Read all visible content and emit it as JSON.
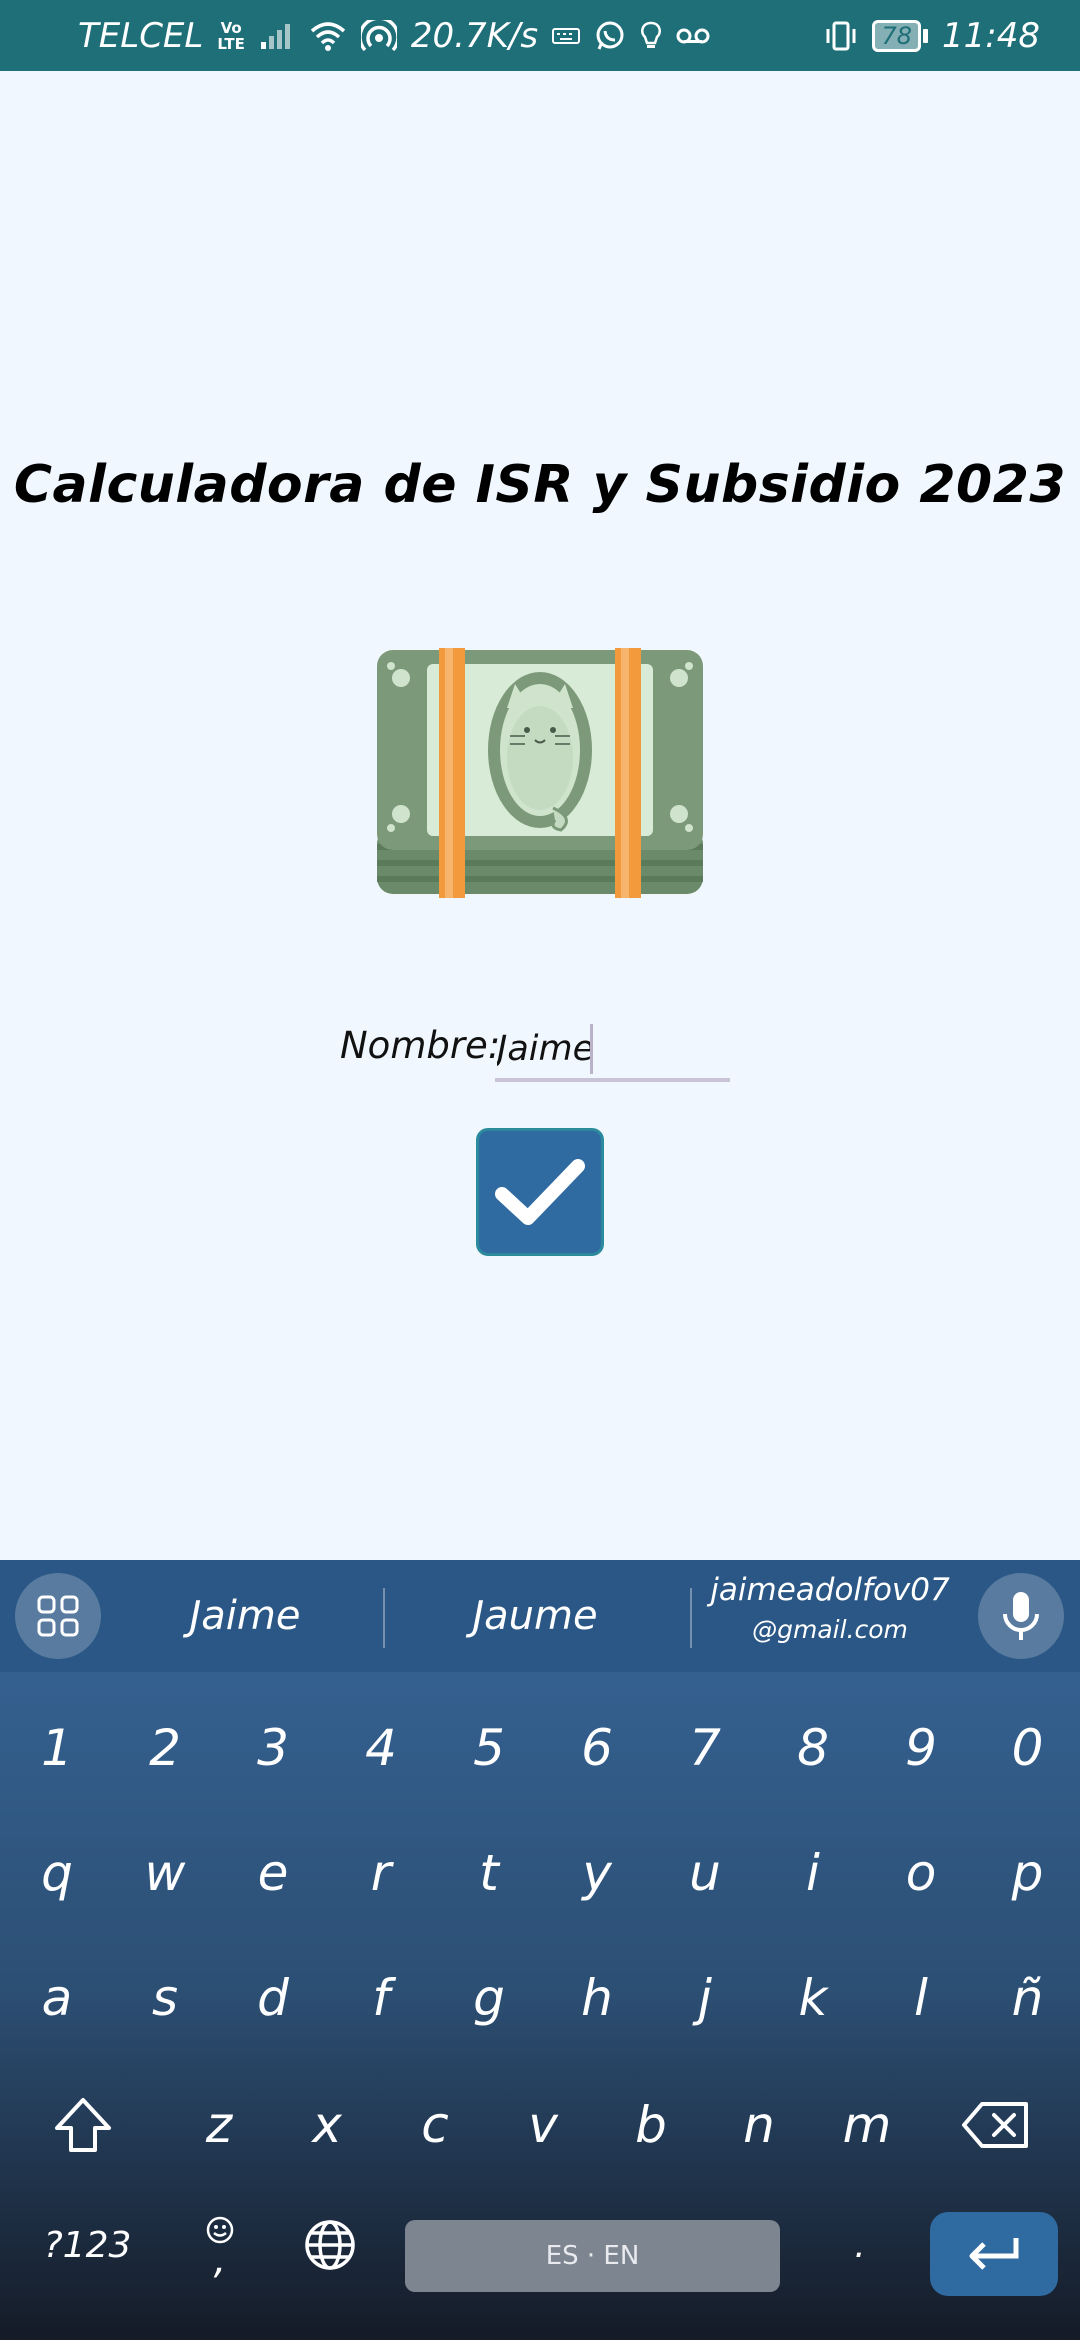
{
  "status_bar": {
    "carrier": "TELCEL",
    "volte_top": "Vo",
    "volte_bottom": "LTE",
    "net_speed": "20.7K/s",
    "battery": "78",
    "time": "11:48"
  },
  "app": {
    "title": "Calculadora de ISR y Subsidio 2023",
    "name_label": "Nombre:",
    "name_value": "Jaime"
  },
  "keyboard": {
    "suggestions": [
      "Jaime",
      "Jaume"
    ],
    "email_line1": "jaimeadolfov07",
    "email_line2": "@gmail.com",
    "number_row": [
      "1",
      "2",
      "3",
      "4",
      "5",
      "6",
      "7",
      "8",
      "9",
      "0"
    ],
    "row1": [
      "q",
      "w",
      "e",
      "r",
      "t",
      "y",
      "u",
      "i",
      "o",
      "p"
    ],
    "row2": [
      "a",
      "s",
      "d",
      "f",
      "g",
      "h",
      "j",
      "k",
      "l",
      "ñ"
    ],
    "row3": [
      "z",
      "x",
      "c",
      "v",
      "b",
      "n",
      "m"
    ],
    "symbols_label": "?123",
    "comma": ",",
    "space_label": "ES · EN",
    "period": "."
  },
  "colors": {
    "status_bar": "#1f6f78",
    "background": "#f0f7fe",
    "accent": "#2f6aa1"
  }
}
